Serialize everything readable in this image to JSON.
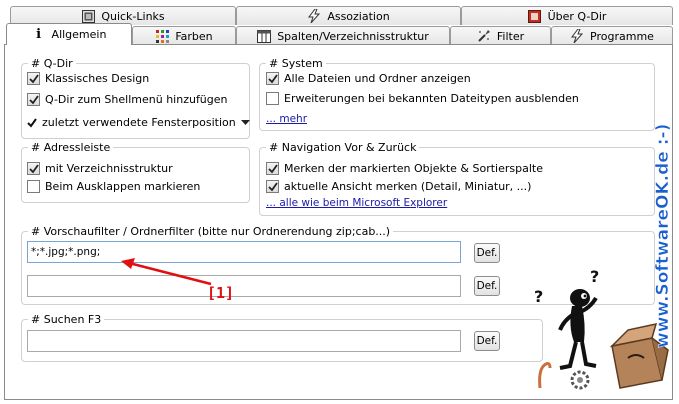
{
  "tabs_top": [
    {
      "label": "Quick-Links",
      "icon": "quick-links-icon"
    },
    {
      "label": "Assoziation",
      "icon": "lightning-icon"
    },
    {
      "label": "Über Q-Dir",
      "icon": "about-icon"
    }
  ],
  "tabs_bottom": [
    {
      "label": "Allgemein",
      "icon": "info-icon"
    },
    {
      "label": "Farben",
      "icon": "palette-icon"
    },
    {
      "label": "Spalten/Verzeichnisstruktur",
      "icon": "columns-icon"
    },
    {
      "label": "Filter",
      "icon": "filter-icon"
    },
    {
      "label": "Programme",
      "icon": "programs-icon"
    }
  ],
  "qdir": {
    "legend": "# Q-Dir",
    "classic_design": "Klassisches Design",
    "shell_menu": "Q-Dir zum Shellmenü hinzufügen",
    "window_position": "zuletzt verwendete Fensterposition"
  },
  "system": {
    "legend": "# System",
    "show_all": "Alle Dateien und Ordner anzeigen",
    "hide_ext": "Erweiterungen bei bekannten Dateitypen ausblenden",
    "more": "... mehr"
  },
  "address": {
    "legend": "# Adressleiste",
    "with_tree": "mit Verzeichnisstruktur",
    "mark_expand": "Beim Ausklappen markieren"
  },
  "navigation": {
    "legend": "# Navigation Vor & Zurück",
    "remember_marked": "Merken der markierten Objekte & Sortierspalte",
    "remember_view": "aktuelle Ansicht merken (Detail, Miniatur, ...)",
    "like_explorer": "... alle wie beim Microsoft Explorer"
  },
  "prefilter": {
    "legend": "# Vorschaufilter / Ordnerfilter (bitte nur Ordnerendung zip;cab...)",
    "value1": "*;*.jpg;*.png;",
    "value2": "",
    "def_label": "Def."
  },
  "search": {
    "legend": "# Suchen   F3",
    "value": "",
    "def_label": "Def."
  },
  "annotation": "[1]",
  "watermark": "www.SoftwareOK.de :-)",
  "colors": {
    "annotation": "#e01010",
    "watermark": "#1a5fd0"
  }
}
